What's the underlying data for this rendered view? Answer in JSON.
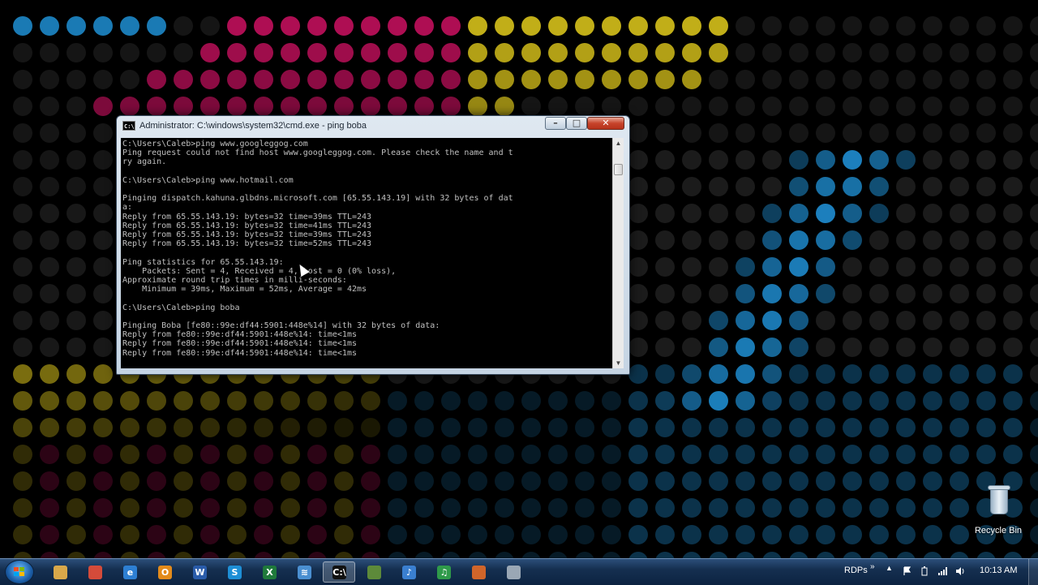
{
  "window": {
    "title": "Administrator: C:\\windows\\system32\\cmd.exe - ping  boba",
    "icon_glyph": "C:\\",
    "minimize_glyph": "–",
    "maximize_glyph": "□",
    "close_glyph": "✕"
  },
  "console_lines": [
    "C:\\Users\\Caleb>ping www.googleggog.com",
    "Ping request could not find host www.googleggog.com. Please check the name and t",
    "ry again.",
    "",
    "C:\\Users\\Caleb>ping www.hotmail.com",
    "",
    "Pinging dispatch.kahuna.glbdns.microsoft.com [65.55.143.19] with 32 bytes of dat",
    "a:",
    "Reply from 65.55.143.19: bytes=32 time=39ms TTL=243",
    "Reply from 65.55.143.19: bytes=32 time=41ms TTL=243",
    "Reply from 65.55.143.19: bytes=32 time=39ms TTL=243",
    "Reply from 65.55.143.19: bytes=32 time=52ms TTL=243",
    "",
    "Ping statistics for 65.55.143.19:",
    "    Packets: Sent = 4, Received = 4, Lost = 0 (0% loss),",
    "Approximate round trip times in milli-seconds:",
    "    Minimum = 39ms, Maximum = 52ms, Average = 42ms",
    "",
    "C:\\Users\\Caleb>ping boba",
    "",
    "Pinging Boba [fe80::99e:df44:5901:448e%14] with 32 bytes of data:",
    "Reply from fe80::99e:df44:5901:448e%14: time<1ms",
    "Reply from fe80::99e:df44:5901:448e%14: time<1ms",
    "Reply from fe80::99e:df44:5901:448e%14: time<1ms"
  ],
  "desktop": {
    "recycle_bin_label": "Recycle Bin"
  },
  "taskbar": {
    "pinned": [
      {
        "name": "explorer-icon",
        "glyph": "",
        "color": "#d9a84a"
      },
      {
        "name": "chrome-icon",
        "glyph": "",
        "color": "#d44b3a"
      },
      {
        "name": "internet-explorer-icon",
        "glyph": "e",
        "color": "#2d7fd3"
      },
      {
        "name": "outlook-icon",
        "glyph": "O",
        "color": "#e38b1b"
      },
      {
        "name": "word-icon",
        "glyph": "W",
        "color": "#2a5caa"
      },
      {
        "name": "skype-icon",
        "glyph": "S",
        "color": "#1e8fd6"
      },
      {
        "name": "excel-icon",
        "glyph": "X",
        "color": "#1f7a3b"
      },
      {
        "name": "network-icon",
        "glyph": "≋",
        "color": "#4a8fd1"
      },
      {
        "name": "cmd-icon",
        "glyph": "C:\\",
        "color": "#111111"
      },
      {
        "name": "minecraft-icon",
        "glyph": "",
        "color": "#5d8a3a"
      },
      {
        "name": "itunes-icon",
        "glyph": "♪",
        "color": "#3a7fd0"
      },
      {
        "name": "music-app-icon",
        "glyph": "♫",
        "color": "#2f9a4a"
      },
      {
        "name": "powerpoint-icon",
        "glyph": "",
        "color": "#d0652a"
      },
      {
        "name": "window-icon",
        "glyph": "",
        "color": "#9aa7b5"
      }
    ],
    "tray": {
      "rdps_label": "RDPs",
      "overflow_glyph": "»",
      "show_hidden_glyph": "▲",
      "clock": "10:13 AM"
    }
  },
  "colors": {
    "dot_magenta": "#c8105f",
    "dot_yellow": "#d9c31b",
    "dot_blue": "#1f8fd4",
    "dot_dark": "#1e1e1e",
    "console_text": "#c0c0c0"
  }
}
